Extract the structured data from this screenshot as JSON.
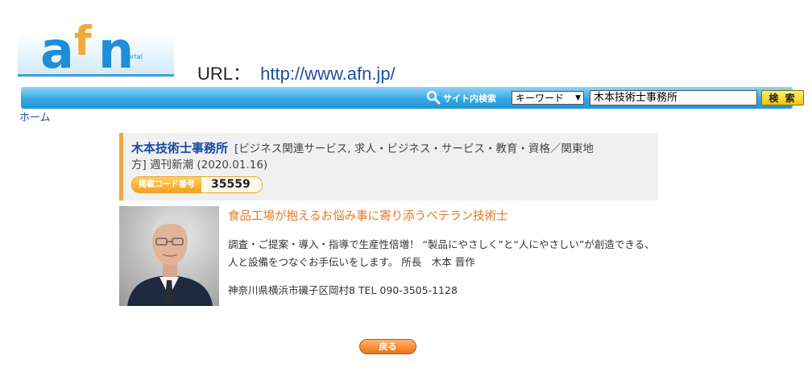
{
  "logo": {
    "text": "afn",
    "sub": "Portal"
  },
  "url_line": {
    "label": "URL：",
    "url": "http://www.afn.jp/"
  },
  "search": {
    "label": "サイト内検索",
    "select_value": "キーワード",
    "input_value": "木本技術士事務所",
    "button_label": "検 索"
  },
  "breadcrumb": {
    "home": "ホーム"
  },
  "listing": {
    "name": "木本技術士事務所",
    "categories_line1": "[ビジネス関連サービス, 求人・ビジネス・サービス・教育・資格／関東地",
    "categories_line2": "方] 週刊新潮 (2020.01.16)",
    "code_label": "掲載コード番号",
    "code_value": "35559",
    "tagline": "食品工場が抱えるお悩み事に寄り添うベテラン技術士",
    "description": "調査・ご提案・導入・指導で生産性倍増！ “製品にやさしく”と“人にやさしい”が創造できる、人と設備をつなぐお手伝いをします。 所長　木本 晋作",
    "address": "神奈川県横浜市磯子区岡村8  TEL 090-3505-1128"
  },
  "back_button": "戻る",
  "colors": {
    "accent_blue": "#36a9e6",
    "orange": "#f2a93b",
    "name_blue": "#1648a5"
  }
}
